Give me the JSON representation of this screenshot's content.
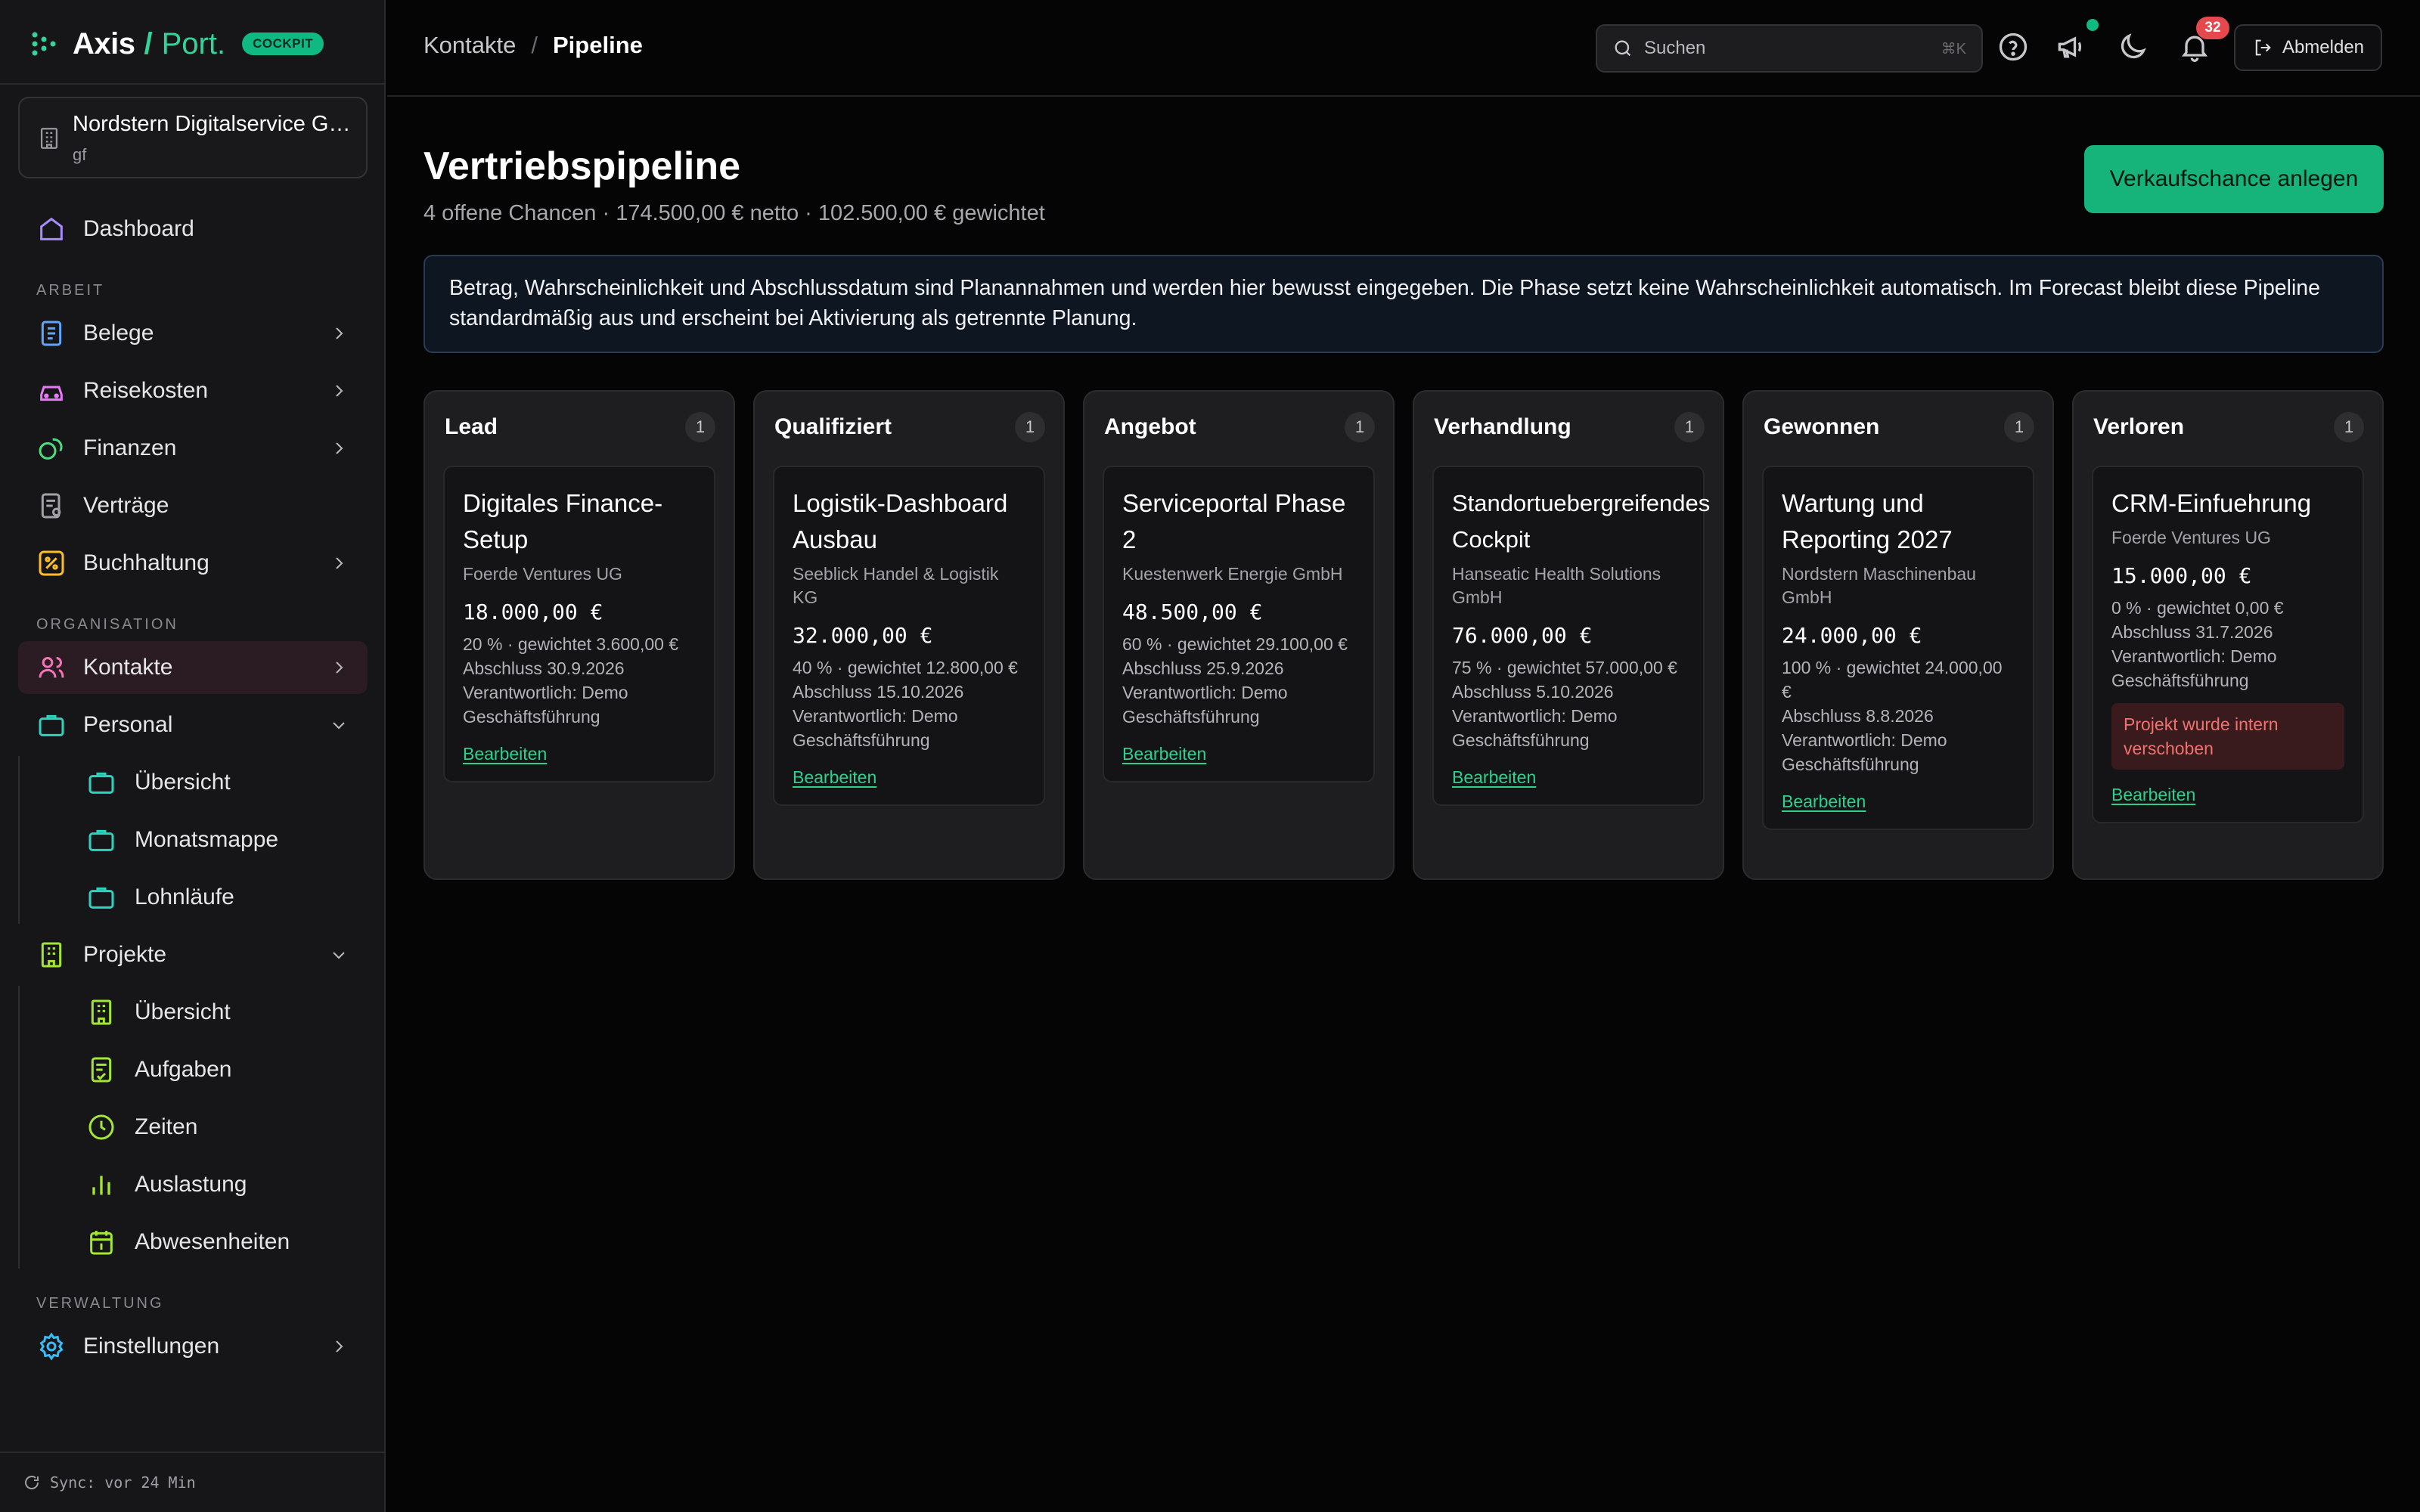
{
  "brand": {
    "name": "Axis",
    "slash": "/",
    "suffix": "Port.",
    "badge": "COCKPIT",
    "accent": "#34d399"
  },
  "tenant": {
    "name": "Nordstern Digitalservice GmbH",
    "sub": "gf"
  },
  "sidebar": {
    "dashboard": "Dashboard",
    "sections": {
      "arbeit": "ARBEIT",
      "organisation": "ORGANISATION",
      "verwaltung": "VERWALTUNG"
    },
    "items": {
      "belege": "Belege",
      "reisekosten": "Reisekosten",
      "finanzen": "Finanzen",
      "vertraege": "Verträge",
      "buchhaltung": "Buchhaltung",
      "kontakte": "Kontakte",
      "personal": "Personal",
      "projekte": "Projekte",
      "einstellungen": "Einstellungen"
    },
    "personal_sub": [
      "Übersicht",
      "Monatsmappe",
      "Lohnläufe"
    ],
    "projekte_sub": [
      "Übersicht",
      "Aufgaben",
      "Zeiten",
      "Auslastung",
      "Abwesenheiten"
    ],
    "sync": "Sync: vor 24 Min"
  },
  "header": {
    "breadcrumb": [
      "Kontakte",
      "Pipeline"
    ],
    "search_placeholder": "Suchen",
    "search_shortcut": "⌘K",
    "notifications_count": "32",
    "logout": "Abmelden"
  },
  "main": {
    "title": "Vertriebspipeline",
    "subtitle": "4 offene Chancen · 174.500,00 € netto · 102.500,00 € gewichtet",
    "cta": "Verkaufschance anlegen",
    "info": "Betrag, Wahrscheinlichkeit und Abschlussdatum sind Planannahmen und werden hier bewusst eingegeben. Die Phase setzt keine Wahrscheinlichkeit automatisch. Im Forecast bleibt diese Pipeline standardmäßig aus und erscheint bei Aktivierung als getrennte Planung.",
    "columns": [
      {
        "title": "Lead",
        "count": "1",
        "card": {
          "title": "Digitales Finance-Setup",
          "company": "Foerde Ventures UG",
          "amount": "18.000,00 €",
          "prob": "20 % · gewichtet 3.600,00 €",
          "close": "Abschluss 30.9.2026",
          "owner": "Verantwortlich: Demo Geschäftsführung",
          "note": "",
          "link": "Bearbeiten"
        }
      },
      {
        "title": "Qualifiziert",
        "count": "1",
        "card": {
          "title": "Logistik-Dashboard Ausbau",
          "company": "Seeblick Handel & Logistik KG",
          "amount": "32.000,00 €",
          "prob": "40 % · gewichtet 12.800,00 €",
          "close": "Abschluss 15.10.2026",
          "owner": "Verantwortlich: Demo Geschäftsführung",
          "note": "",
          "link": "Bearbeiten"
        }
      },
      {
        "title": "Angebot",
        "count": "1",
        "card": {
          "title": "Serviceportal Phase 2",
          "company": "Kuestenwerk Energie GmbH",
          "amount": "48.500,00 €",
          "prob": "60 % · gewichtet 29.100,00 €",
          "close": "Abschluss 25.9.2026",
          "owner": "Verantwortlich: Demo Geschäftsführung",
          "note": "",
          "link": "Bearbeiten"
        }
      },
      {
        "title": "Verhandlung",
        "count": "1",
        "card": {
          "title": "Standortuebergreifendes Cockpit",
          "company": "Hanseatic Health Solutions GmbH",
          "amount": "76.000,00 €",
          "prob": "75 % · gewichtet 57.000,00 €",
          "close": "Abschluss 5.10.2026",
          "owner": "Verantwortlich: Demo Geschäftsführung",
          "note": "",
          "link": "Bearbeiten"
        }
      },
      {
        "title": "Gewonnen",
        "count": "1",
        "card": {
          "title": "Wartung und Reporting 2027",
          "company": "Nordstern Maschinenbau GmbH",
          "amount": "24.000,00 €",
          "prob": "100 % · gewichtet 24.000,00 €",
          "close": "Abschluss 8.8.2026",
          "owner": "Verantwortlich: Demo Geschäftsführung",
          "note": "",
          "link": "Bearbeiten"
        }
      },
      {
        "title": "Verloren",
        "count": "1",
        "card": {
          "title": "CRM-Einfuehrung",
          "company": "Foerde Ventures UG",
          "amount": "15.000,00 €",
          "prob": "0 % · gewichtet 0,00 €",
          "close": "Abschluss 31.7.2026",
          "owner": "Verantwortlich: Demo Geschäftsführung",
          "note": "Projekt wurde intern verschoben",
          "link": "Bearbeiten"
        }
      }
    ]
  },
  "colors": {
    "accent": "#16b37a",
    "danger": "#e5484d",
    "info_bg": "#0e1622"
  }
}
